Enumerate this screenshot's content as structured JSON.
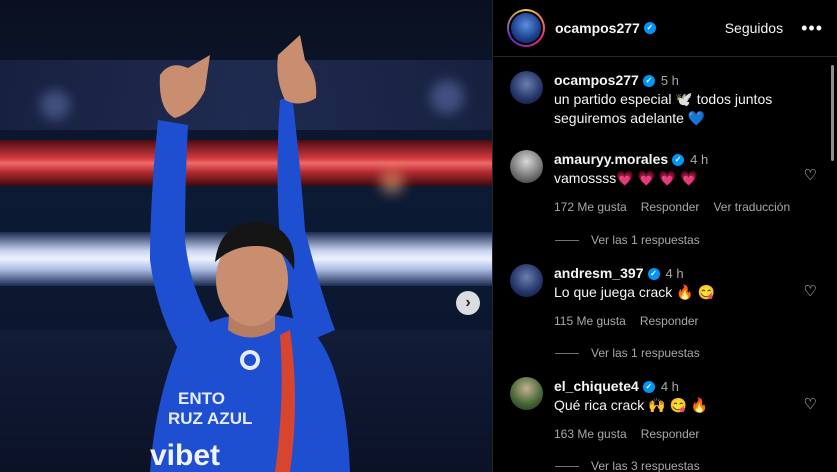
{
  "post": {
    "author": "ocampos277",
    "follow_label": "Seguidos",
    "more_label": "•••",
    "next_label": "›"
  },
  "caption": {
    "username": "ocampos277",
    "time": "5 h",
    "text": "un partido especial 🕊️ todos juntos seguiremos adelante 💙"
  },
  "comments": [
    {
      "username": "amauryy.morales",
      "time": "4 h",
      "text": "vamossss💗 💗 💗 💗",
      "likes": "172 Me gusta",
      "reply": "Responder",
      "translate": "Ver traducción",
      "replies": "Ver las 1 respuestas",
      "heart": "♡"
    },
    {
      "username": "andresm_397",
      "time": "4 h",
      "text": "Lo que juega crack 🔥 😋",
      "likes": "115 Me gusta",
      "reply": "Responder",
      "replies": "Ver las 1 respuestas",
      "heart": "♡"
    },
    {
      "username": "el_chiquete4",
      "time": "4 h",
      "text": "Qué rica crack 🙌 😋 🔥",
      "likes": "163 Me gusta",
      "reply": "Responder",
      "replies": "Ver las 3 respuestas",
      "heart": "♡"
    }
  ],
  "media": {
    "jersey_text_1": "ENTO",
    "jersey_text_2": "RUZ AZUL",
    "sponsor": "vibet"
  },
  "colors": {
    "verified": "#0095f6",
    "jersey": "#1f4fd1",
    "stadium_red": "#d23a3f"
  }
}
